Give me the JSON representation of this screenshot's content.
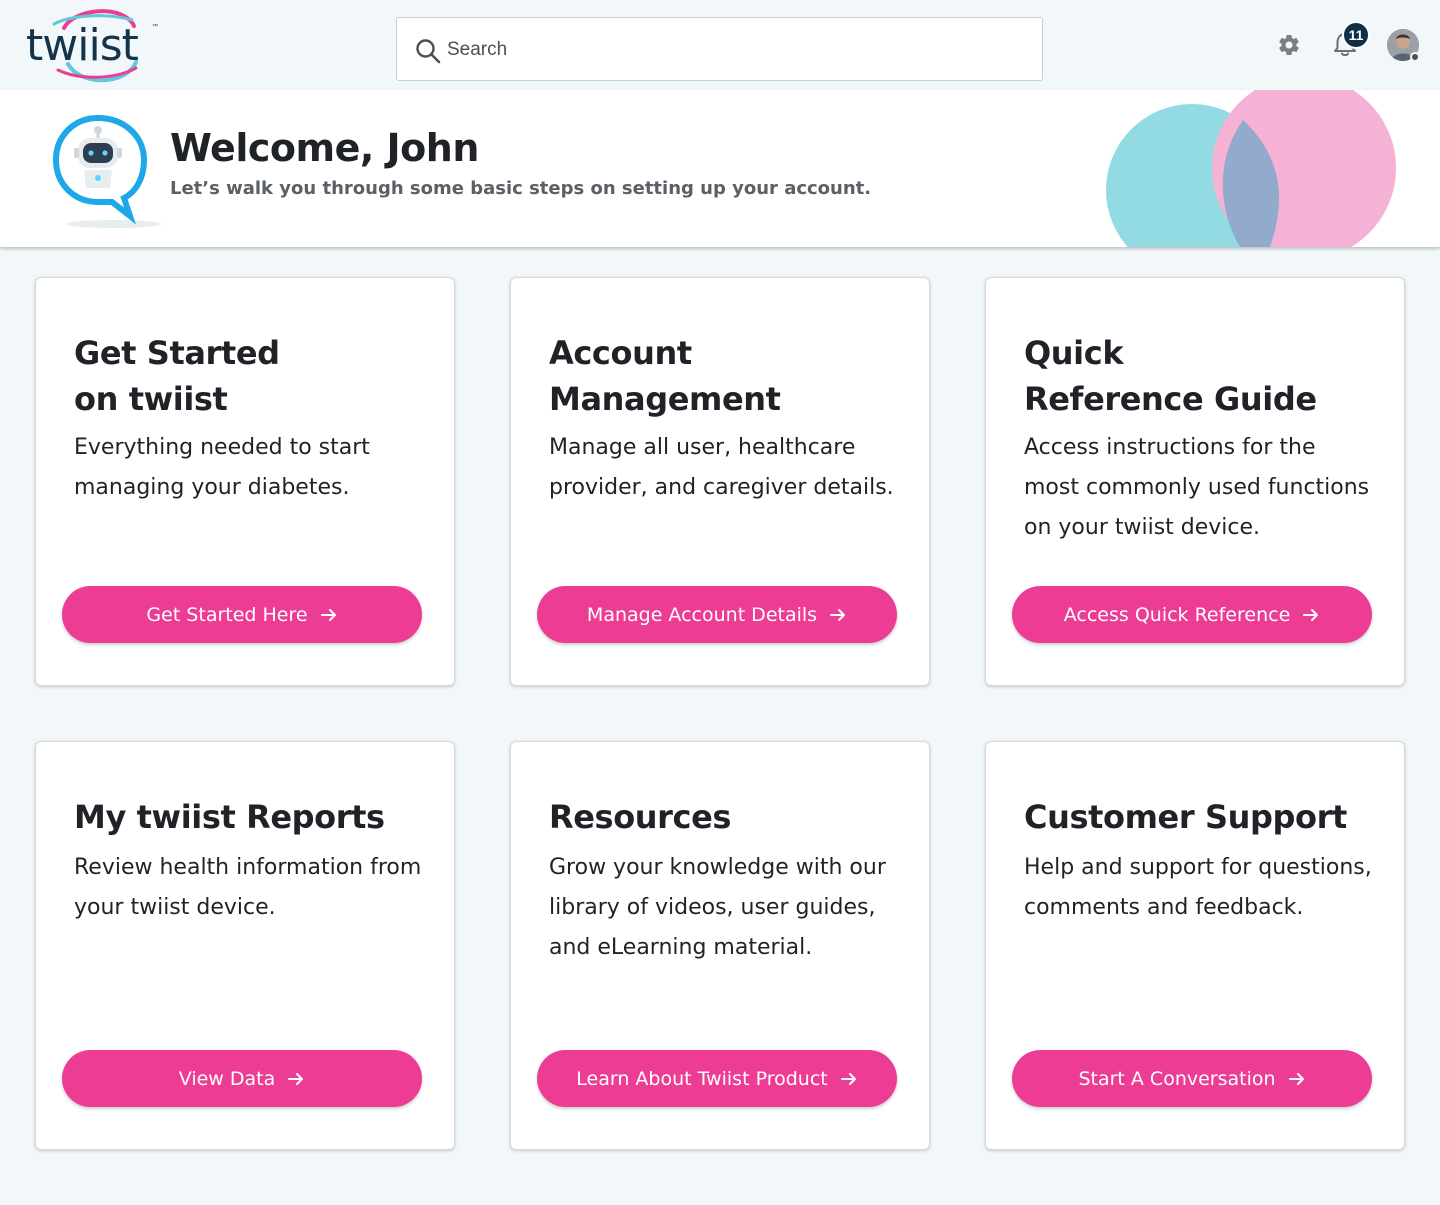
{
  "brand": {
    "logo_text": "twiist",
    "accent": "#ec3c94",
    "navy": "#13344a"
  },
  "search": {
    "placeholder": "Search",
    "value": ""
  },
  "header": {
    "notification_count": "11",
    "icons": [
      "search-icon",
      "gear-icon",
      "bell-icon",
      "avatar"
    ]
  },
  "welcome": {
    "title": "Welcome, John",
    "subtitle": "Let’s walk you through some basic steps on setting up your account."
  },
  "cards": [
    {
      "title_lines": [
        "Get Started",
        "on twiist"
      ],
      "description": "Everything needed to start managing your diabetes.",
      "button": "Get Started Here"
    },
    {
      "title_lines": [
        "Account",
        "Management"
      ],
      "description": "Manage all user, healthcare provider, and caregiver details.",
      "button": "Manage Account Details"
    },
    {
      "title_lines": [
        "Quick",
        "Reference Guide"
      ],
      "description": "Access instructions for the most commonly used functions on your twiist device.",
      "button": "Access Quick Reference"
    },
    {
      "title_lines": [
        "My twiist Reports"
      ],
      "description": "Review health information from your twiist device.",
      "button": "View Data"
    },
    {
      "title_lines": [
        "Resources"
      ],
      "description": "Grow your knowledge with our library of videos, user guides, and eLearning material.",
      "button": "Learn About Twiist Product"
    },
    {
      "title_lines": [
        "Customer Support"
      ],
      "description": "Help and support for questions, comments and feedback.",
      "button": "Start A Conversation"
    }
  ]
}
